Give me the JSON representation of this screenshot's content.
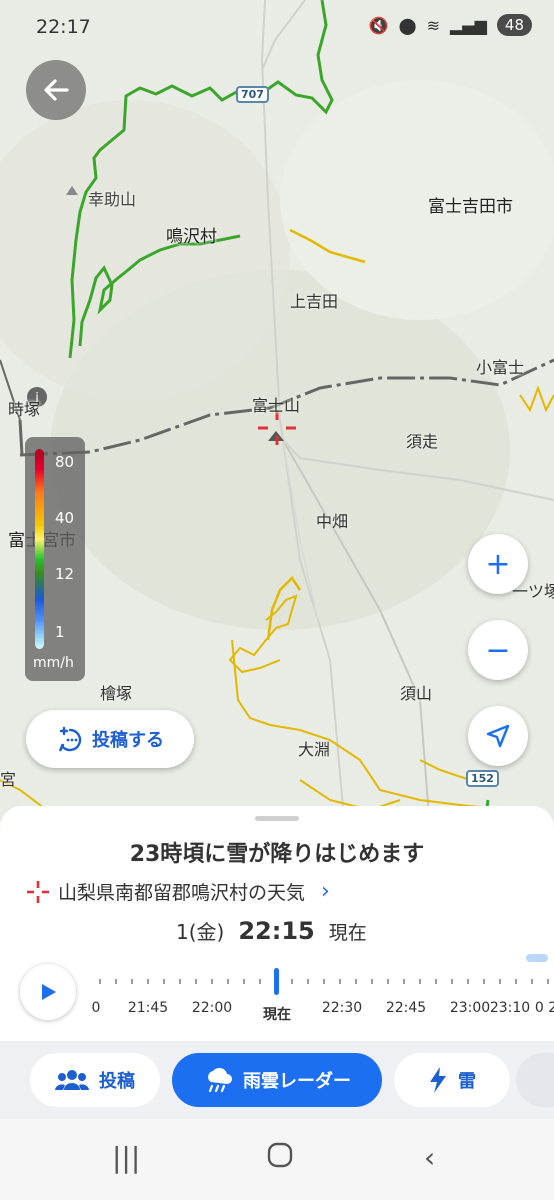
{
  "status_bar": {
    "time": "22:17",
    "battery": "48"
  },
  "map": {
    "labels": {
      "kosukeyama": "幸助山",
      "narusawa": "鳴沢村",
      "fujiyoshida": "富士吉田市",
      "kamiyoshida": "上吉田",
      "kofuji": "小富士",
      "fujisan": "富士山",
      "suso": "須走",
      "kuromon": "中畑",
      "fujinomiya": "富士宮市",
      "hitotsuka": "一ツ塚",
      "hinokizuka": "檜塚",
      "suyama": "須山",
      "obuchi": "大淵",
      "gotsuka": "時塚",
      "miya": "宮",
      "route_707": "707",
      "route_152": "152"
    },
    "legend": {
      "ticks": [
        "80",
        "40",
        "12",
        "1"
      ],
      "unit": "mm/h"
    },
    "controls": {
      "zoom_in": "+",
      "zoom_out": "−"
    },
    "post_button": "投稿する"
  },
  "sheet": {
    "headline": "23時頃に雪が降りはじめます",
    "location": "山梨県南都留郡鳴沢村の天気",
    "date": "1(金)",
    "time": "22:15",
    "now_label": "現在",
    "timeline": {
      "labels": [
        "0",
        "21:45",
        "22:00",
        "現在",
        "22:30",
        "22:45",
        "23:00",
        "23:10",
        "0 2"
      ],
      "current": "現在"
    }
  },
  "tabs": [
    {
      "label": "投稿",
      "icon": "people-icon"
    },
    {
      "label": "雨雲レーダー",
      "icon": "rain-cloud-icon",
      "active": true
    },
    {
      "label": "雷",
      "icon": "lightning-icon"
    }
  ],
  "colors": {
    "accent": "#1d6ff2",
    "rain_line": "#3aa62a",
    "road_yellow": "#e3b800"
  }
}
